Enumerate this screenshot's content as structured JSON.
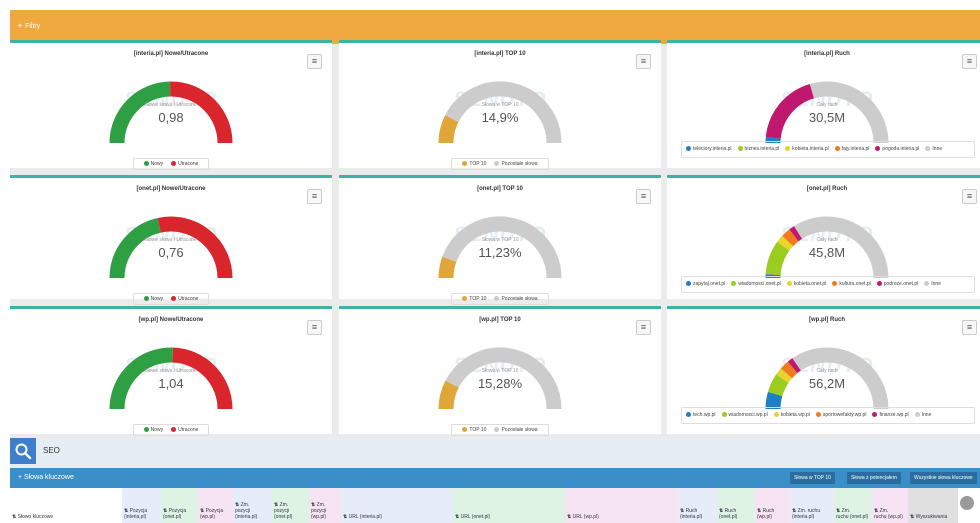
{
  "filter_bar": {
    "label": "Filtry"
  },
  "cards": [
    {
      "title": "[interia.pl] Nowe/Utracone",
      "gauge_label": "Nowe słowa / Utracone",
      "value": "0,98",
      "legend": [
        {
          "label": "Nowy",
          "color": "#2ea043"
        },
        {
          "label": "Utracone",
          "color": "#d9262c"
        }
      ]
    },
    {
      "title": "[interia.pl] TOP 10",
      "gauge_label": "Słowa w TOP 10",
      "value": "14,9%",
      "legend": [
        {
          "label": "TOP 10",
          "color": "#e0a63a"
        },
        {
          "label": "Pozostałe słowa",
          "color": "#cccccc"
        }
      ]
    },
    {
      "title": "[interia.pl] Ruch",
      "gauge_label": "Cały ruch",
      "value": "30,5M",
      "legend": [
        {
          "label": "teleciory.interia.pl",
          "color": "#1f7fc4"
        },
        {
          "label": "biznes.interia.pl",
          "color": "#9bcc1f"
        },
        {
          "label": "kobieta.interia.pl",
          "color": "#e8d42a"
        },
        {
          "label": "fajy.interia.pl",
          "color": "#f07b1b"
        },
        {
          "label": "pogoda.interia.pl",
          "color": "#c0176f"
        },
        {
          "label": "Inne",
          "color": "#cccccc"
        }
      ]
    },
    {
      "title": "[onet.pl] Nowe/Utracone",
      "gauge_label": "Nowe słowa / Utracone",
      "value": "0,76",
      "legend": [
        {
          "label": "Nowy",
          "color": "#2ea043"
        },
        {
          "label": "Utracone",
          "color": "#d9262c"
        }
      ]
    },
    {
      "title": "[onet.pl] TOP 10",
      "gauge_label": "Słowa w TOP 10",
      "value": "11,23%",
      "legend": [
        {
          "label": "TOP 10",
          "color": "#e0a63a"
        },
        {
          "label": "Pozostałe słowa",
          "color": "#cccccc"
        }
      ]
    },
    {
      "title": "[onet.pl] Ruch",
      "gauge_label": "Cały ruch",
      "value": "45,8M",
      "legend": [
        {
          "label": "zapytaj.onet.pl",
          "color": "#1f7fc4"
        },
        {
          "label": "wiadomosci.onet.pl",
          "color": "#9bcc1f"
        },
        {
          "label": "kobieta.onet.pl",
          "color": "#e8d42a"
        },
        {
          "label": "kultura.onet.pl",
          "color": "#f07b1b"
        },
        {
          "label": "podroze.onet.pl",
          "color": "#c0176f"
        },
        {
          "label": "Inne",
          "color": "#cccccc"
        }
      ]
    },
    {
      "title": "[wp.pl] Nowe/Utracone",
      "gauge_label": "Nowe słowa / Utracone",
      "value": "1,04",
      "legend": [
        {
          "label": "Nowy",
          "color": "#2ea043"
        },
        {
          "label": "Utracone",
          "color": "#d9262c"
        }
      ]
    },
    {
      "title": "[wp.pl] TOP 10",
      "gauge_label": "Słowa w TOP 10",
      "value": "15,28%",
      "legend": [
        {
          "label": "TOP 10",
          "color": "#e0a63a"
        },
        {
          "label": "Pozostałe słowa",
          "color": "#cccccc"
        }
      ]
    },
    {
      "title": "[wp.pl] Ruch",
      "gauge_label": "Cały ruch",
      "value": "56,2M",
      "legend": [
        {
          "label": "tech.wp.pl",
          "color": "#1f7fc4"
        },
        {
          "label": "wiadomosci.wp.pl",
          "color": "#9bcc1f"
        },
        {
          "label": "kobieta.wp.pl",
          "color": "#e8d42a"
        },
        {
          "label": "sportowefakty.wp.pl",
          "color": "#f07b1b"
        },
        {
          "label": "finanse.wp.pl",
          "color": "#c0176f"
        },
        {
          "label": "Inne",
          "color": "#cccccc"
        }
      ]
    }
  ],
  "watermark": "SENUTO",
  "seo": {
    "query": "SEO"
  },
  "keywords": {
    "title": "Słowa kluczowe",
    "buttons": [
      "Słowa w TOP 10",
      "Słowa z potencjałem",
      "Wszystkie słowa kluczowe"
    ],
    "columns": [
      {
        "line1": "Słowo kluczowe",
        "line2": ""
      },
      {
        "line1": "Pozycja",
        "line2": "(interia.pl)"
      },
      {
        "line1": "Pozycja",
        "line2": "(onet.pl)"
      },
      {
        "line1": "Pozycja",
        "line2": "(wp.pl)"
      },
      {
        "line1": "Zm.",
        "line2": "pozycji (interia.pl)"
      },
      {
        "line1": "Zm.",
        "line2": "pozycji (onet.pl)"
      },
      {
        "line1": "Zm.",
        "line2": "pozycji (wp.pl)"
      },
      {
        "line1": "URL (interia.pl)",
        "line2": ""
      },
      {
        "line1": "URL (onet.pl)",
        "line2": ""
      },
      {
        "line1": "URL (wp.pl)",
        "line2": ""
      },
      {
        "line1": "Ruch",
        "line2": "(interia.pl)"
      },
      {
        "line1": "Ruch",
        "line2": "(onet.pl)"
      },
      {
        "line1": "Ruch",
        "line2": "(wp.pl)"
      },
      {
        "line1": "Zm. ruchu",
        "line2": "(interia.pl)"
      },
      {
        "line1": "Zm.",
        "line2": "ruchu (onet.pl)"
      },
      {
        "line1": "Zm.",
        "line2": "ruchu (wp.pl)"
      },
      {
        "line1": "Wyszukiwania",
        "line2": ""
      }
    ]
  },
  "chart_data": [
    {
      "type": "gauge",
      "title": "[interia.pl] Nowe/Utracone",
      "series": [
        {
          "name": "Nowy",
          "value": 49.5
        },
        {
          "name": "Utracone",
          "value": 50.5
        }
      ]
    },
    {
      "type": "gauge",
      "title": "[interia.pl] TOP 10",
      "series": [
        {
          "name": "TOP 10",
          "value": 14.9
        },
        {
          "name": "Pozostałe słowa",
          "value": 85.1
        }
      ]
    },
    {
      "type": "gauge",
      "title": "[interia.pl] Ruch",
      "series": [
        {
          "name": "teleciory.interia.pl",
          "value": 3
        },
        {
          "name": "pogoda.interia.pl",
          "value": 38
        },
        {
          "name": "Inne",
          "value": 59
        }
      ]
    },
    {
      "type": "gauge",
      "title": "[onet.pl] Nowe/Utracone",
      "series": [
        {
          "name": "Nowy",
          "value": 43
        },
        {
          "name": "Utracone",
          "value": 57
        }
      ]
    },
    {
      "type": "gauge",
      "title": "[onet.pl] TOP 10",
      "series": [
        {
          "name": "TOP 10",
          "value": 11.23
        },
        {
          "name": "Pozostałe słowa",
          "value": 88.77
        }
      ]
    },
    {
      "type": "gauge",
      "title": "[onet.pl] Ruch",
      "series": [
        {
          "name": "zapytaj.onet.pl",
          "value": 2
        },
        {
          "name": "wiadomosci.onet.pl",
          "value": 18
        },
        {
          "name": "kobieta.onet.pl",
          "value": 4
        },
        {
          "name": "kultura.onet.pl",
          "value": 5
        },
        {
          "name": "podroze.onet.pl",
          "value": 3
        },
        {
          "name": "Inne",
          "value": 68
        }
      ]
    },
    {
      "type": "gauge",
      "title": "[wp.pl] Nowe/Utracone",
      "series": [
        {
          "name": "Nowy",
          "value": 51
        },
        {
          "name": "Utracone",
          "value": 49
        }
      ]
    },
    {
      "type": "gauge",
      "title": "[wp.pl] TOP 10",
      "series": [
        {
          "name": "TOP 10",
          "value": 15.28
        },
        {
          "name": "Pozostałe słowa",
          "value": 84.72
        }
      ]
    },
    {
      "type": "gauge",
      "title": "[wp.pl] Ruch",
      "series": [
        {
          "name": "tech.wp.pl",
          "value": 9
        },
        {
          "name": "wiadomosci.wp.pl",
          "value": 10
        },
        {
          "name": "kobieta.wp.pl",
          "value": 4
        },
        {
          "name": "sportowefakty.wp.pl",
          "value": 5
        },
        {
          "name": "finanse.wp.pl",
          "value": 3
        },
        {
          "name": "Inne",
          "value": 69
        }
      ]
    }
  ]
}
